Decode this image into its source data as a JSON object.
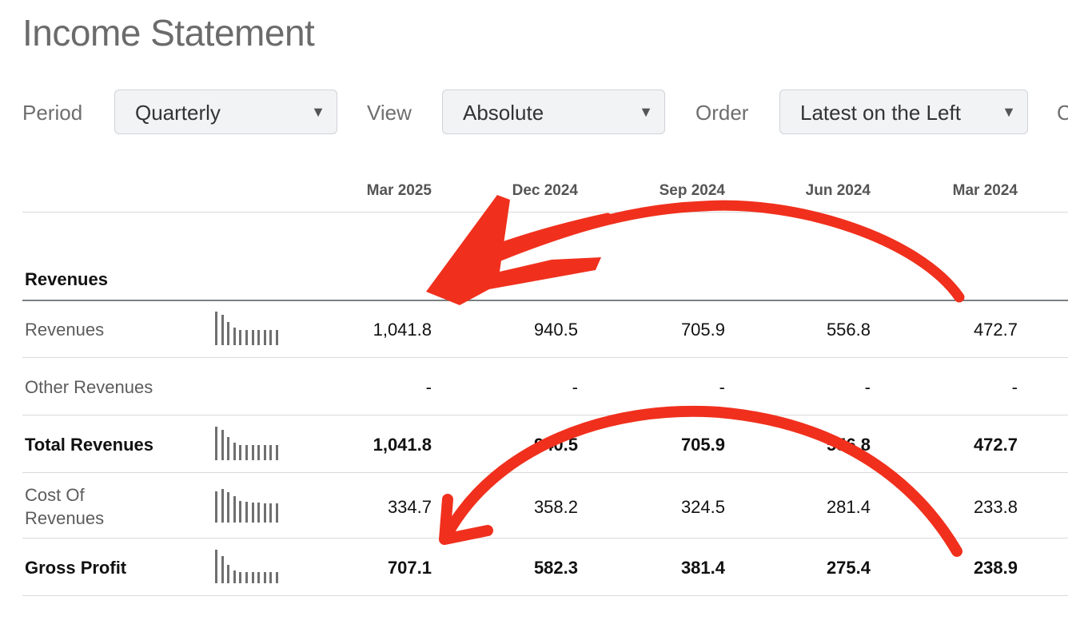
{
  "page_title": "Income Statement",
  "filters": {
    "period_label": "Period",
    "period_value": "Quarterly",
    "view_label": "View",
    "view_value": "Absolute",
    "order_label": "Order",
    "order_value": "Latest on the Left",
    "next_label_partial": "C"
  },
  "columns": [
    "Mar 2025",
    "Dec 2024",
    "Sep 2024",
    "Jun 2024",
    "Mar 2024"
  ],
  "section": "Revenues",
  "rows": [
    {
      "label": "Revenues",
      "values": [
        "1,041.8",
        "940.5",
        "705.9",
        "556.8",
        "472.7"
      ],
      "bold": false
    },
    {
      "label": "Other Revenues",
      "values": [
        "-",
        "-",
        "-",
        "-",
        "-"
      ],
      "bold": false
    },
    {
      "label": "Total Revenues",
      "values": [
        "1,041.8",
        "940.5",
        "705.9",
        "556.8",
        "472.7"
      ],
      "bold": true
    },
    {
      "label": "Cost Of Revenues",
      "values": [
        "334.7",
        "358.2",
        "324.5",
        "281.4",
        "233.8"
      ],
      "bold": false
    },
    {
      "label": "Gross Profit",
      "values": [
        "707.1",
        "582.3",
        "381.4",
        "275.4",
        "238.9"
      ],
      "bold": true
    }
  ],
  "sparkline_levels": {
    "revenues": [
      1.0,
      0.9,
      0.68,
      0.53,
      0.45,
      0.45,
      0.45,
      0.45,
      0.45,
      0.45,
      0.45
    ],
    "cost_of_revenues": [
      0.93,
      1.0,
      0.91,
      0.79,
      0.65,
      0.62,
      0.6,
      0.6,
      0.58,
      0.58,
      0.56
    ],
    "gross_profit": [
      1.0,
      0.82,
      0.54,
      0.39,
      0.34,
      0.34,
      0.34,
      0.34,
      0.34,
      0.34,
      0.34
    ]
  },
  "annotation_color": "#f0301d"
}
